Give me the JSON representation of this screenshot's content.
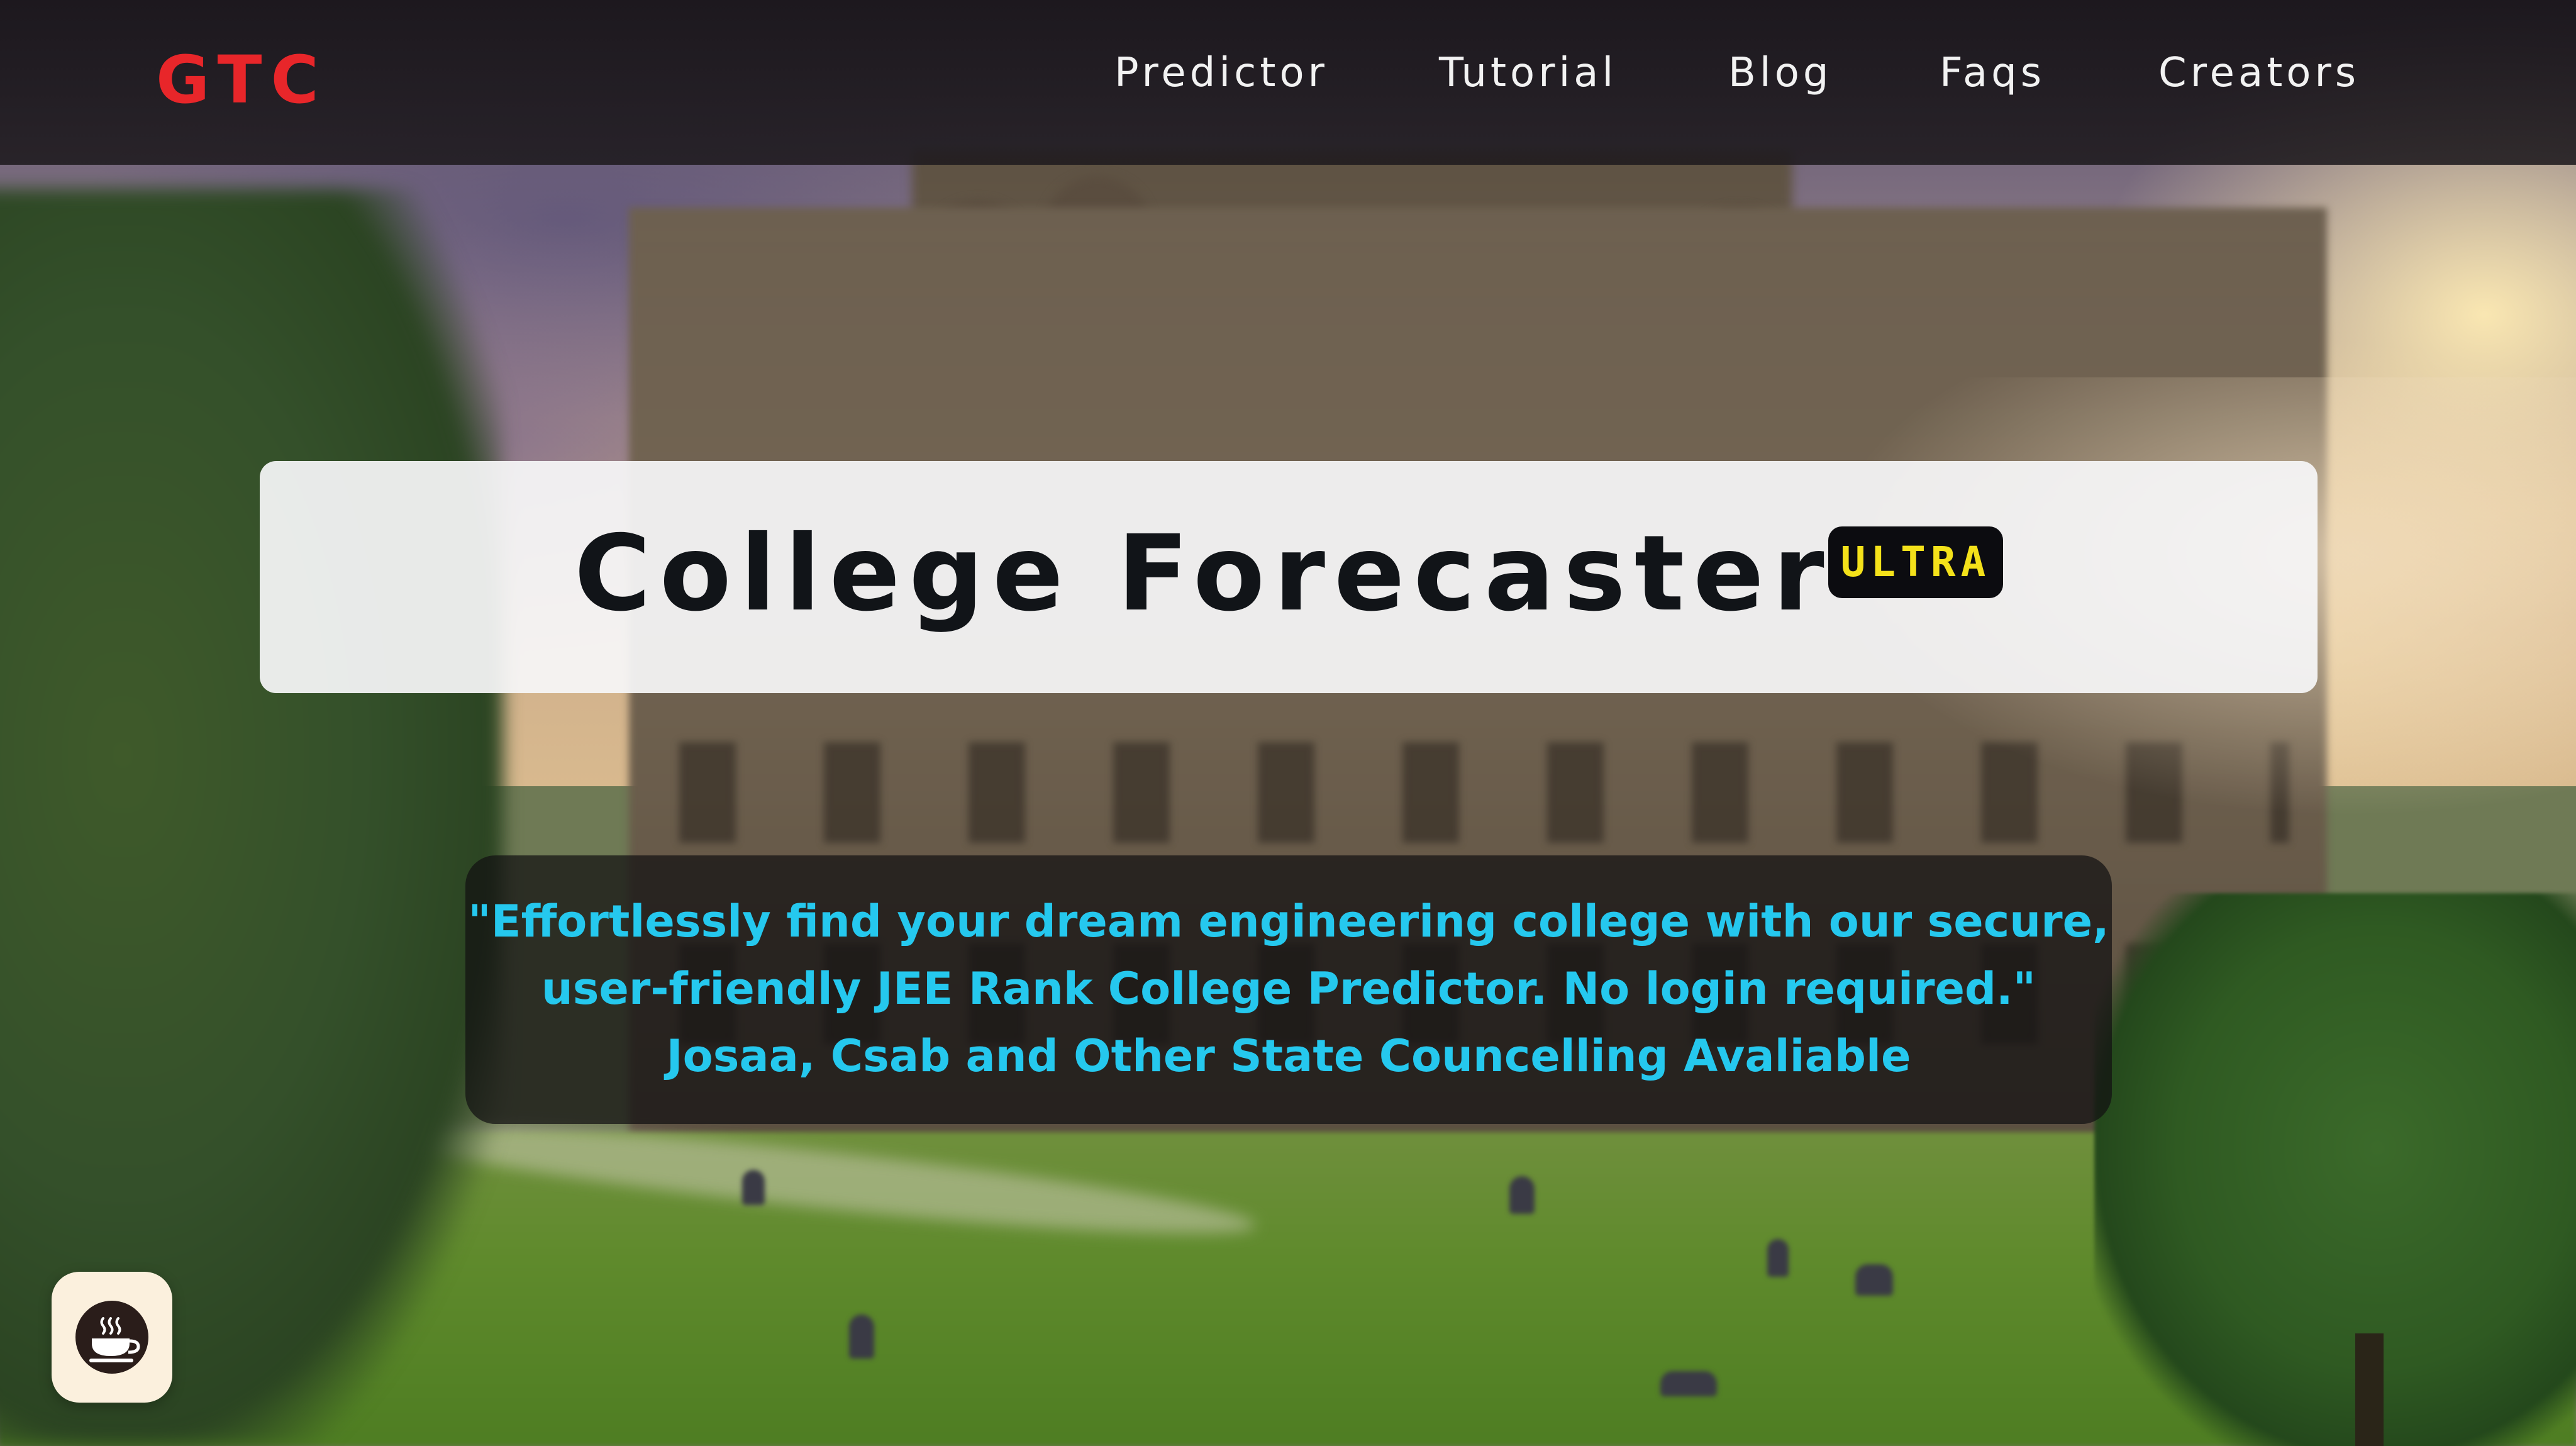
{
  "brand": {
    "logo_text": "GTC",
    "logo_color": "#e8262a"
  },
  "nav": {
    "items": [
      {
        "label": "Predictor"
      },
      {
        "label": "Tutorial"
      },
      {
        "label": "Blog"
      },
      {
        "label": "Faqs"
      },
      {
        "label": "Creators"
      }
    ]
  },
  "hero": {
    "title": "College Forecaster",
    "badge": "ULTRA",
    "badge_color": "#f4e11a"
  },
  "tagline": {
    "lines": [
      "\"Effortlessly find your dream engineering college with our secure,",
      "user-friendly JEE Rank College Predictor. No login required.\"",
      "Josaa, Csab and Other State Councelling Avaliable"
    ],
    "text_color": "#25c8ee"
  },
  "floating_button": {
    "icon": "coffee-cup-icon"
  }
}
